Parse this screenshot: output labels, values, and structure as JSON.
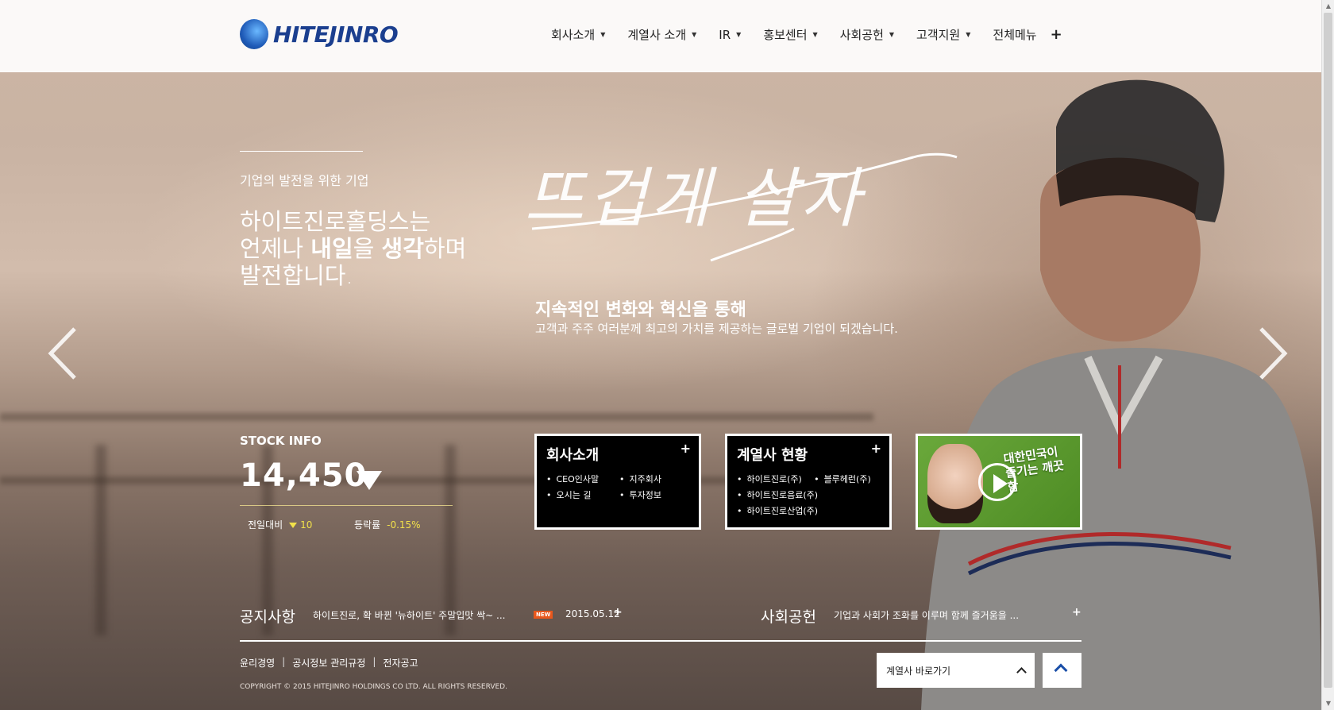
{
  "brand": {
    "logo_text": "HITEJINRO"
  },
  "nav": {
    "items": [
      {
        "label": "회사소개"
      },
      {
        "label": "계열사 소개"
      },
      {
        "label": "IR"
      },
      {
        "label": "홍보센터"
      },
      {
        "label": "사회공헌"
      },
      {
        "label": "고객지원"
      }
    ],
    "all_menu": "전체메뉴"
  },
  "hero": {
    "eyebrow": "기업의 발전을 위한 기업",
    "headline_line1": "하이트진로홀딩스는",
    "headline_line2_a": "언제나 ",
    "headline_line2_b": "내일",
    "headline_line2_c": "을 ",
    "headline_line2_d": "생각",
    "headline_line2_e": "하며",
    "headline_line3": "발전합니다.",
    "script_slogan": "뜨겁게 살자",
    "subhead": "지속적인 변화와 혁신을 통해",
    "subcopy": "고객과 주주 여러분께 최고의 가치를 제공하는 글로벌 기업이 되겠습니다."
  },
  "stock": {
    "label": "STOCK INFO",
    "price": "14,450",
    "direction": "down",
    "change_label": "전일대비",
    "change_value": "10",
    "rate_label": "등락률",
    "rate_value": "-0.15%"
  },
  "cards": {
    "company": {
      "title": "회사소개",
      "items": [
        "CEO인사말",
        "지주회사",
        "오시는 길",
        "투자정보"
      ]
    },
    "affiliates": {
      "title": "계열사 현황",
      "items": [
        "하이트진로(주)",
        "블루헤런(주)",
        "하이트진로음료(주)",
        "하이트진로산업(주)"
      ]
    },
    "video": {
      "caption": "대한민국이 즐기는 깨끗함"
    }
  },
  "notice": {
    "title": "공지사항",
    "text": "하이트진로, 확 바뀐 '뉴하이트' 주말입맛 싹~ ...",
    "badge": "NEW",
    "date": "2015.05.12"
  },
  "csr": {
    "title": "사회공헌",
    "text": "기업과 사회가 조화를 이루며 함께 즐거움을 ..."
  },
  "footer": {
    "links": [
      "윤리경영",
      "공시정보 관리규정",
      "전자공고"
    ],
    "copyright": "COPYRIGHT © 2015 HITEJINRO HOLDINGS CO LTD. ALL RIGHTS RESERVED.",
    "family_select": "계열사 바로가기"
  },
  "colors": {
    "accent_yellow": "#f2e14a",
    "brand_blue": "#1b3f8f",
    "new_badge": "#e8571c"
  }
}
